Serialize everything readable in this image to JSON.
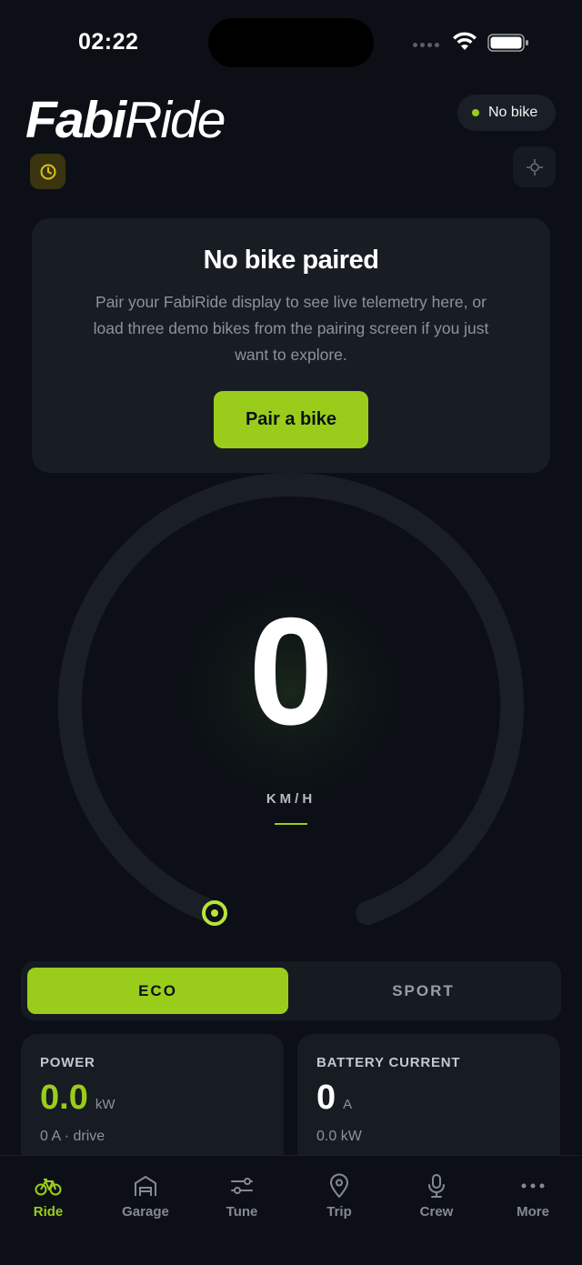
{
  "status_bar": {
    "time": "02:22"
  },
  "header": {
    "logo_part1": "Fabi",
    "logo_part2": "Ride",
    "status_pill": "No bike"
  },
  "pair_card": {
    "title": "No bike paired",
    "description": "Pair your FabiRide display to see live telemetry here, or load three demo bikes from the pairing screen if you just want to explore.",
    "button_label": "Pair a bike"
  },
  "speedometer": {
    "value": "0",
    "unit": "KM/H"
  },
  "mode_toggle": {
    "eco_label": "ECO",
    "sport_label": "SPORT",
    "selected": "ECO"
  },
  "stats": {
    "power": {
      "label": "POWER",
      "value": "0.0",
      "unit": "kW",
      "sub": "0 A · drive"
    },
    "battery_current": {
      "label": "BATTERY CURRENT",
      "value": "0",
      "unit": "A",
      "sub": "0.0 kW"
    }
  },
  "tab_bar": {
    "tabs": [
      {
        "label": "Ride",
        "icon": "bike-icon",
        "active": true
      },
      {
        "label": "Garage",
        "icon": "garage-icon",
        "active": false
      },
      {
        "label": "Tune",
        "icon": "sliders-icon",
        "active": false
      },
      {
        "label": "Trip",
        "icon": "map-pin-icon",
        "active": false
      },
      {
        "label": "Crew",
        "icon": "microphone-icon",
        "active": false
      },
      {
        "label": "More",
        "icon": "more-dots-icon",
        "active": false
      }
    ]
  },
  "colors": {
    "accent": "#9acd1b",
    "background": "#0c1016",
    "card": "#181c23"
  }
}
